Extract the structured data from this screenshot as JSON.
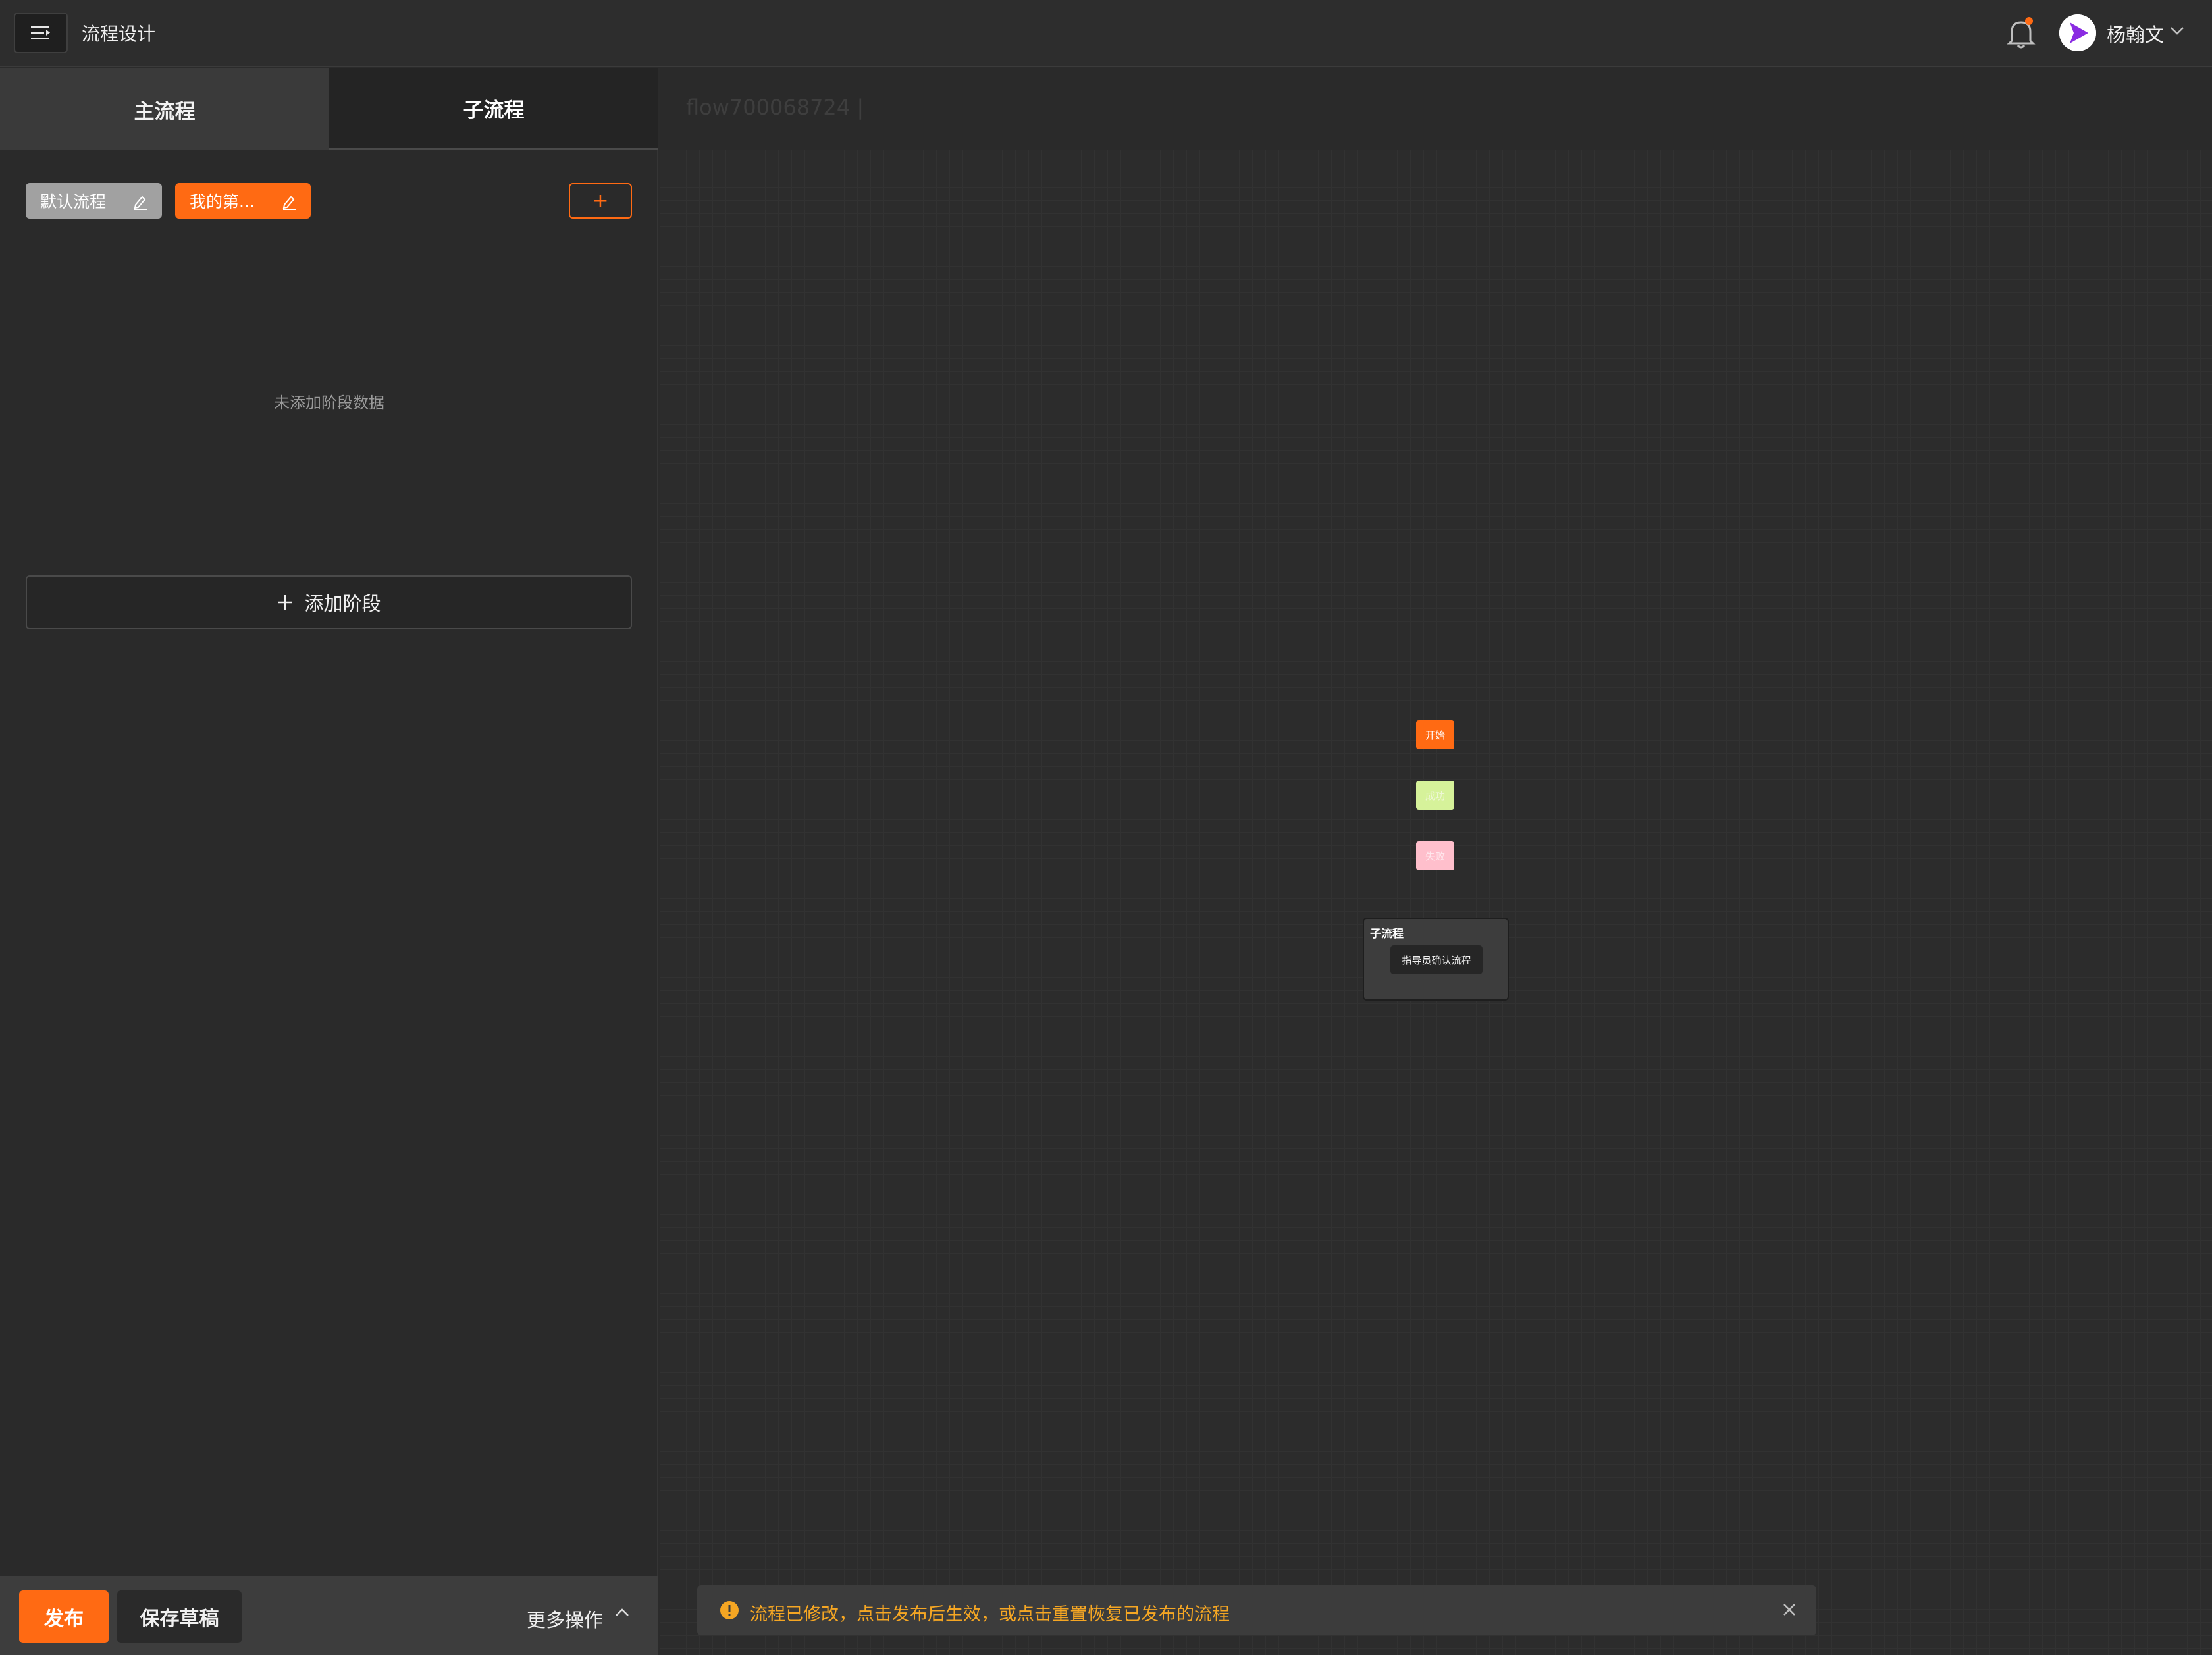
{
  "header": {
    "title": "流程设计",
    "user_name": "杨翰文",
    "notification_dot_color": "#ff6a13"
  },
  "left_panel": {
    "tabs": [
      {
        "label": "主流程",
        "active": false
      },
      {
        "label": "子流程",
        "active": true
      }
    ],
    "flow_tags": [
      {
        "label": "默认流程",
        "color": "#a1a1a1"
      },
      {
        "label": "我的第...",
        "color": "#ff6a13"
      }
    ],
    "add_flow_label": "+",
    "empty_text": "未添加阶段数据",
    "add_stage_label": "添加阶段",
    "bottom": {
      "publish_label": "发布",
      "save_draft_label": "保存草稿",
      "more_label": "更多操作"
    }
  },
  "canvas": {
    "flow_id": "flow700068724 |",
    "nodes": {
      "start": "开始",
      "success": "成功",
      "fail": "失败"
    },
    "subflow": {
      "title": "子流程",
      "item": "指导员确认流程"
    }
  },
  "notice": {
    "text": "流程已修改，点击发布后生效，或点击重置恢复已发布的流程",
    "color": "#f5a623"
  },
  "colors": {
    "accent": "#ff6a13",
    "background": "#2b2b2b"
  }
}
